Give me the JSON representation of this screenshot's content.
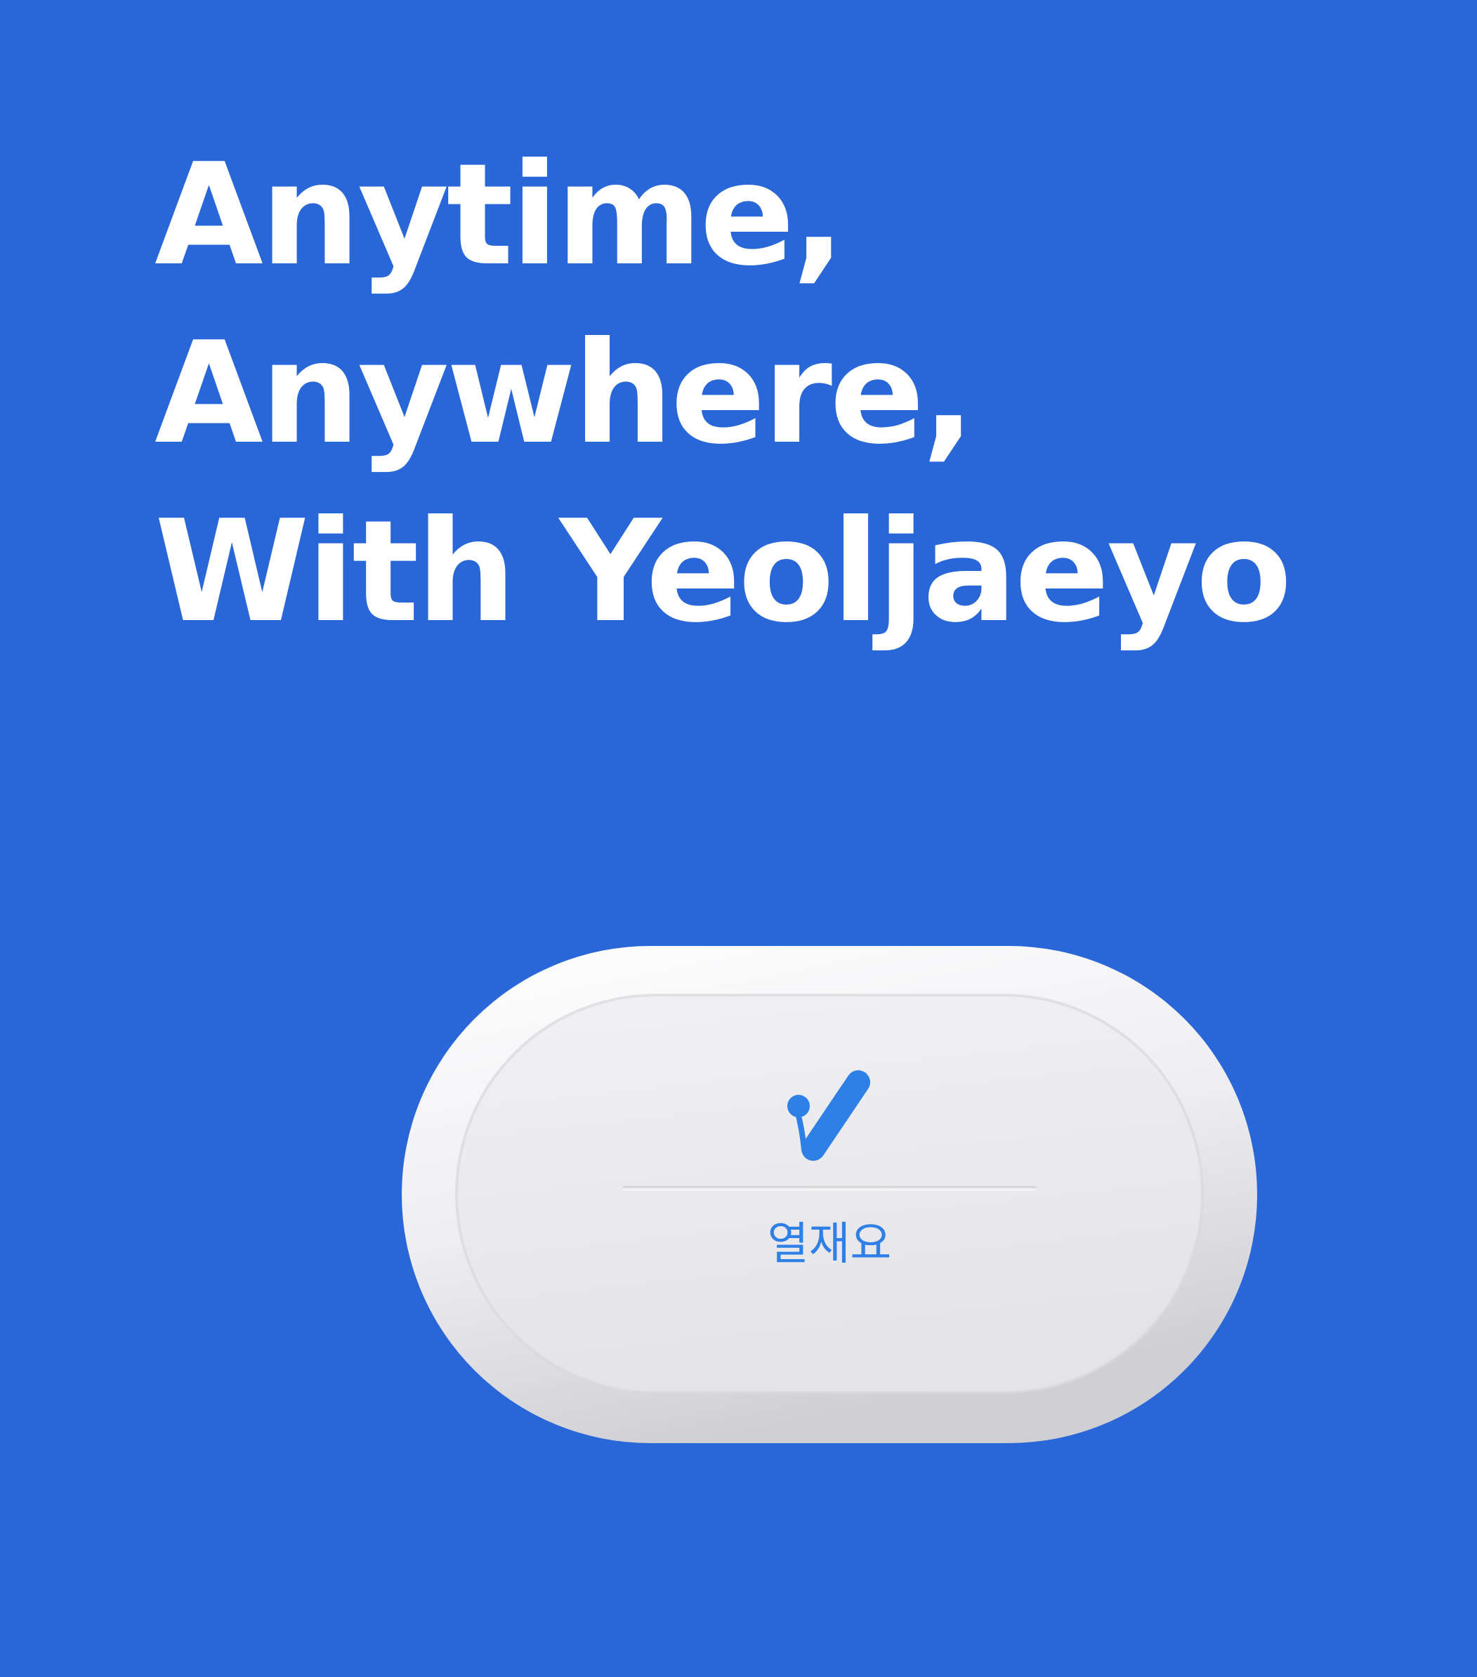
{
  "headline": {
    "line1": "Anytime,",
    "line2": "Anywhere,",
    "line3": "With Yeoljaeyo"
  },
  "device": {
    "logo_icon": "checkmark-icon",
    "logo_text": "열재요",
    "accent_color": "#2f80e6"
  },
  "background_color": "#2966d8"
}
